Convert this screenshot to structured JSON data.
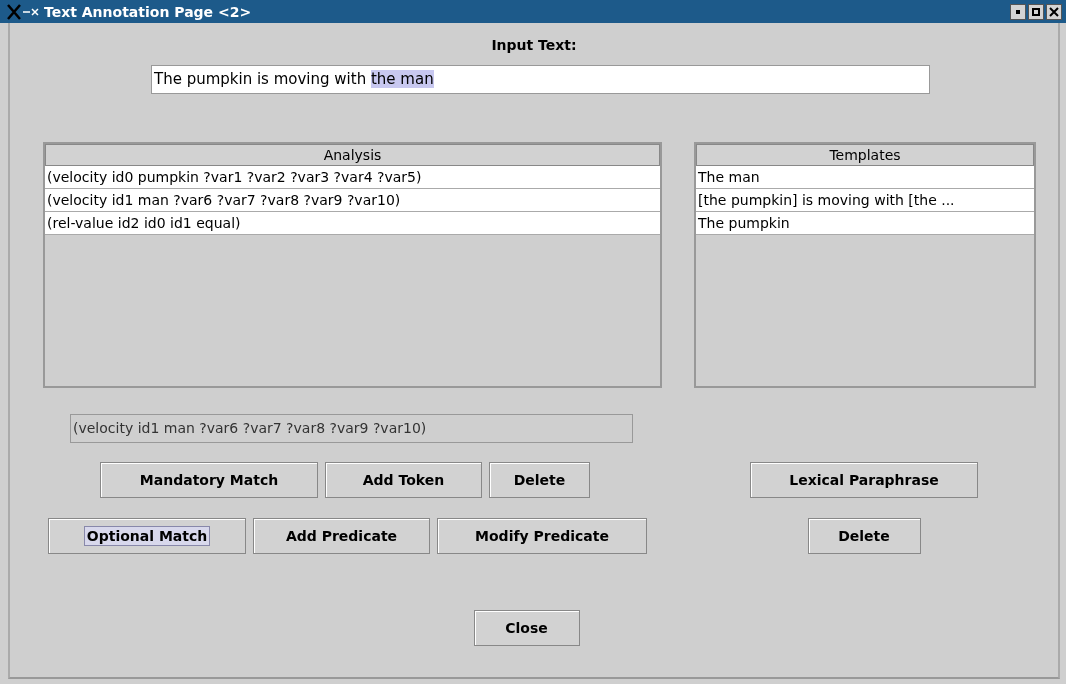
{
  "window": {
    "title": "Text Annotation Page <2>"
  },
  "input": {
    "label": "Input Text:",
    "value": "The pumpkin is moving with ",
    "selected_text": "the man"
  },
  "analysis": {
    "header": "Analysis",
    "rows": [
      {
        "text": "(velocity id0 pumpkin ?var1 ?var2 ?var3 ?var4 ?var5)"
      },
      {
        "text": "(velocity id1 man ?var6 ?var7 ?var8 ?var9 ?var10)"
      },
      {
        "text": "(rel-value id2 id0 id1 equal)"
      }
    ]
  },
  "templates": {
    "header": "Templates",
    "rows": [
      {
        "text": "The man"
      },
      {
        "text": "[the pumpkin] is moving with [the ..."
      },
      {
        "text": "The pumpkin"
      }
    ]
  },
  "current": {
    "value": "(velocity id1 man ?var6 ?var7 ?var8 ?var9 ?var10)"
  },
  "buttons_row1": [
    {
      "label": "Mandatory Match",
      "focused": false
    },
    {
      "label": "Add Token",
      "focused": false
    },
    {
      "label": "Delete",
      "focused": false
    }
  ],
  "buttons_row2": [
    {
      "label": "Optional Match",
      "focused": true
    },
    {
      "label": "Add Predicate",
      "focused": false
    },
    {
      "label": "Modify Predicate",
      "focused": false
    }
  ],
  "template_buttons": [
    {
      "label": "Lexical Paraphrase",
      "focused": false
    },
    {
      "label": "Delete",
      "focused": false
    }
  ],
  "close_button": {
    "label": "Close"
  }
}
